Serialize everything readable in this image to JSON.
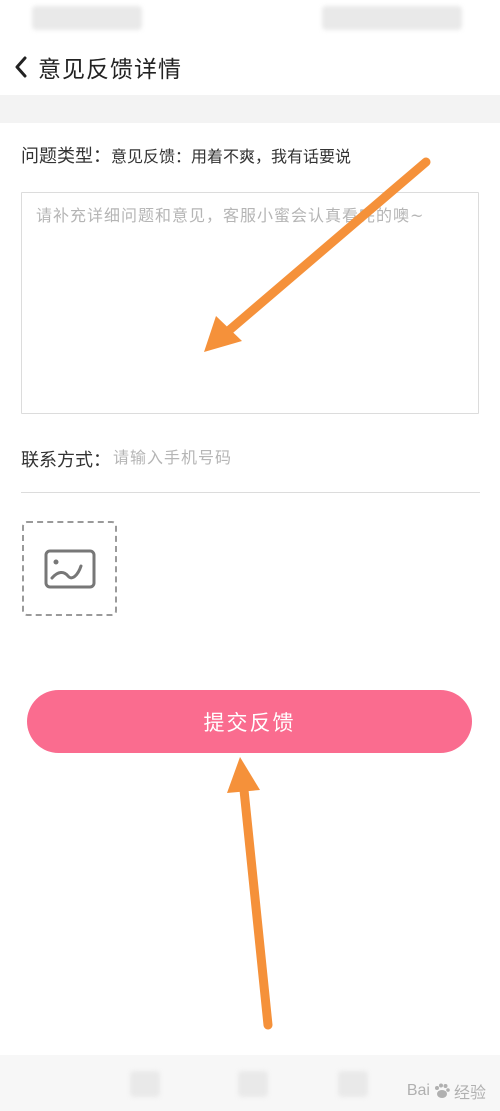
{
  "header": {
    "title": "意见反馈详情"
  },
  "form": {
    "issue_type_label": "问题类型：",
    "issue_type_value": "意见反馈：用着不爽，我有话要说",
    "feedback_placeholder": "请补充详细问题和意见，客服小蜜会认真看完的噢~",
    "contact_label": "联系方式：",
    "contact_placeholder": "请输入手机号码",
    "upload_icon": "image-icon"
  },
  "submit_label": "提交反馈",
  "watermark": {
    "text": "Bai",
    "text2": "经验"
  },
  "colors": {
    "accent": "#fa6c8f",
    "annotation_arrow": "#f5913a",
    "border": "#dcdcdc",
    "placeholder": "#b5b5b5"
  }
}
